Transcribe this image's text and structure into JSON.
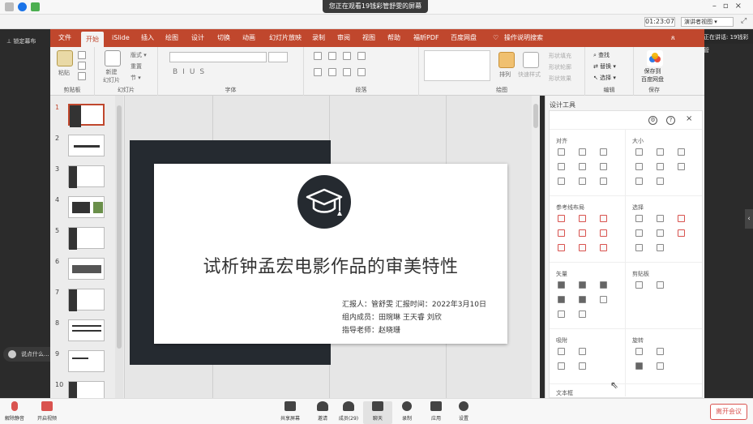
{
  "meeting": {
    "share_banner": "您正在观看19钱彩管舒雯的屏幕",
    "lock_screen": "锁定幕布",
    "chat_float": "说点什么...",
    "speaking": "正在讲话: 19钱彩管",
    "bottom": {
      "unmute": "解除静音",
      "video": "开启视频",
      "share": "共享屏幕",
      "invite": "邀请",
      "members": "成员(29)",
      "chat": "聊天",
      "record": "录制",
      "apps": "应用",
      "settings": "设置",
      "leave": "离开会议"
    }
  },
  "ppt": {
    "timer": "01:23:07",
    "presenter_view": "演讲者视图 ▾",
    "tabs": [
      "文件",
      "开始",
      "iSlide",
      "插入",
      "绘图",
      "设计",
      "切换",
      "动画",
      "幻灯片放映",
      "录制",
      "审阅",
      "视图",
      "帮助",
      "福昕PDF",
      "百度网盘",
      "操作说明搜索"
    ],
    "ribbon": {
      "paste": "粘贴",
      "clipboard": "剪贴板",
      "new_slide": "新建\n幻灯片",
      "layout": "版式 ▾",
      "reset": "重置",
      "section": "节 ▾",
      "slides": "幻灯片",
      "font": "字体",
      "paragraph": "段落",
      "arrange": "排列",
      "quick_styles": "快速样式",
      "shape_fill": "形状填充",
      "shape_outline": "形状轮廓",
      "shape_effects": "形状效果",
      "drawing": "绘图",
      "find": "查找",
      "replace": "替换 ▾",
      "select": "选择 ▾",
      "editing": "编辑",
      "save_to_baidu": "保存到\n百度网盘",
      "save": "保存"
    },
    "thumbnails": [
      "1",
      "2",
      "3",
      "4",
      "5",
      "6",
      "7",
      "8",
      "9",
      "10"
    ],
    "slide": {
      "title": "试析钟孟宏电影作品的审美特性",
      "reporter": "汇报人：管舒雯  汇报时间：2022年3月10日",
      "members": "组内成员：田琬琳 王天睿 刘欣",
      "advisor": "指导老师：赵晓珊"
    },
    "design_panel": {
      "title": "设计工具",
      "sections": {
        "align": "对齐",
        "size": "大小",
        "guides": "参考线布局",
        "select": "选择",
        "vector": "矢量",
        "clipboard": "剪贴板",
        "snap": "吸附",
        "rotate": "旋转",
        "textbox": "文本框"
      }
    }
  },
  "colors": {
    "accent": "#c0472d",
    "slide_dark": "#252a30",
    "leave": "#d9534f"
  }
}
